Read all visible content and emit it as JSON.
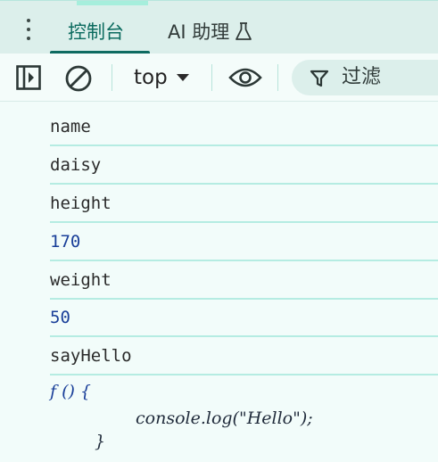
{
  "tabs": {
    "console": "控制台",
    "ai": "AI 助理"
  },
  "toolbar": {
    "context": "top",
    "filter_placeholder": "过滤"
  },
  "console": {
    "rows": [
      {
        "text": "name",
        "kind": "string"
      },
      {
        "text": "daisy",
        "kind": "string"
      },
      {
        "text": "height",
        "kind": "string"
      },
      {
        "text": "170",
        "kind": "number"
      },
      {
        "text": "weight",
        "kind": "string"
      },
      {
        "text": "50",
        "kind": "number"
      },
      {
        "text": "sayHello",
        "kind": "string"
      }
    ],
    "function": {
      "signature": "f () {",
      "body": "console.log(\"Hello\");",
      "close": "}"
    }
  },
  "colors": {
    "accent": "#0e6b61",
    "number": "#1a3f99",
    "divider": "#b5ece2",
    "background": "#f2fcfa"
  },
  "icons": [
    "more-vert-icon",
    "flask-icon",
    "sidebar-toggle-icon",
    "clear-console-icon",
    "dropdown-arrow-icon",
    "eye-icon",
    "filter-icon"
  ]
}
